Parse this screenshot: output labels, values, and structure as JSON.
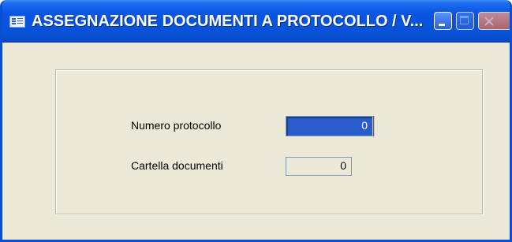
{
  "window": {
    "title": "ASSEGNAZIONE DOCUMENTI A PROTOCOLLO / V...",
    "icon": "app-window-icon"
  },
  "titlebar_buttons": {
    "minimize_icon": "minimize-icon",
    "maximize_icon": "maximize-icon",
    "close_icon": "close-icon"
  },
  "form": {
    "numero_protocollo": {
      "label": "Numero protocollo",
      "value": "0"
    },
    "cartella_documenti": {
      "label": "Cartella documenti",
      "value": "0"
    }
  },
  "colors": {
    "titlebar": "#0a55e3",
    "window_background": "#ece9d8",
    "selected_field": "#2b5ccc"
  }
}
